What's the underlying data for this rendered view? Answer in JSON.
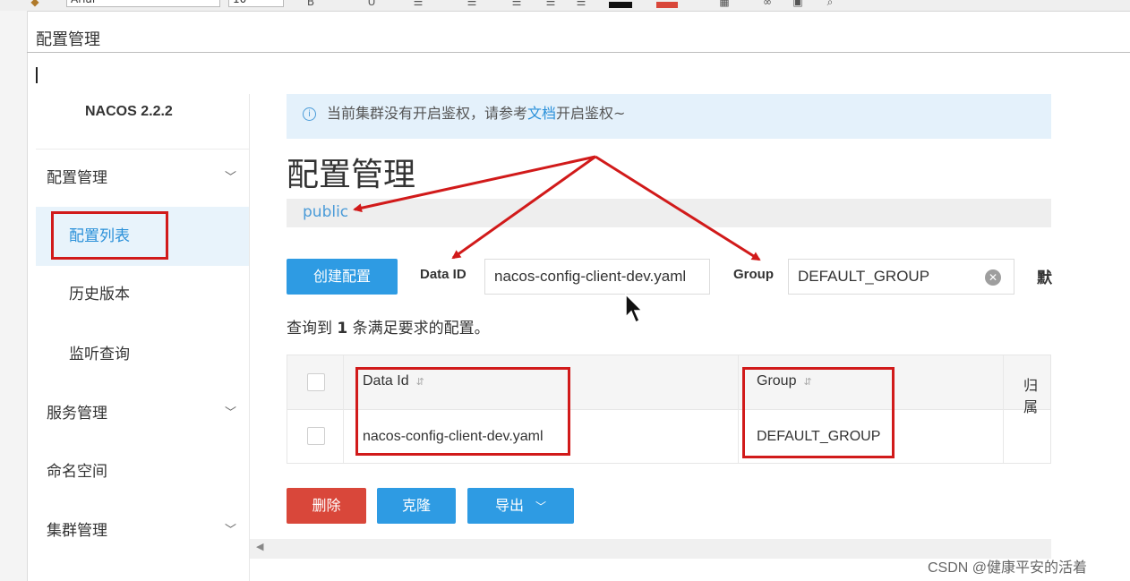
{
  "editor": {
    "font_name": "Arial",
    "font_size": "10",
    "doc_title": "配置管理",
    "toolbar_icons": [
      "bold-icon",
      "italic-icon",
      "underline-icon",
      "align-icon",
      "numbered-list-icon",
      "bullet-list-icon",
      "indent-icon",
      "outdent-icon",
      "text-color-icon",
      "highlight-icon",
      "table-icon",
      "link-icon",
      "image-icon",
      "find-icon"
    ]
  },
  "sidebar": {
    "brand": "NACOS 2.2.2",
    "items": [
      {
        "label": "配置管理",
        "expanded": true
      },
      {
        "label": "配置列表",
        "active": true
      },
      {
        "label": "历史版本"
      },
      {
        "label": "监听查询"
      },
      {
        "label": "服务管理"
      },
      {
        "label": "命名空间"
      },
      {
        "label": "集群管理"
      }
    ]
  },
  "notice": {
    "prefix": "当前集群没有开启鉴权，请参考",
    "link": "文档",
    "suffix": "开启鉴权~"
  },
  "main": {
    "title": "配置管理",
    "namespace": "public",
    "create_button": "创建配置",
    "data_id_label": "Data ID",
    "data_id_value": "nacos-config-client-dev.yaml",
    "group_label": "Group",
    "group_value": "DEFAULT_GROUP",
    "cut_label": "默",
    "result_prefix": "查询到",
    "result_count": "1",
    "result_suffix": "条满足要求的配置。"
  },
  "table": {
    "headers": [
      "Data Id",
      "Group",
      "归属"
    ],
    "rows": [
      {
        "data_id": "nacos-config-client-dev.yaml",
        "group": "DEFAULT_GROUP"
      }
    ]
  },
  "actions": {
    "delete": "删除",
    "clone": "克隆",
    "export": "导出"
  },
  "colors": {
    "primary": "#2e9be3",
    "danger": "#d9473a",
    "annotation": "#d11a1a"
  },
  "watermark": "CSDN @健康平安的活着"
}
